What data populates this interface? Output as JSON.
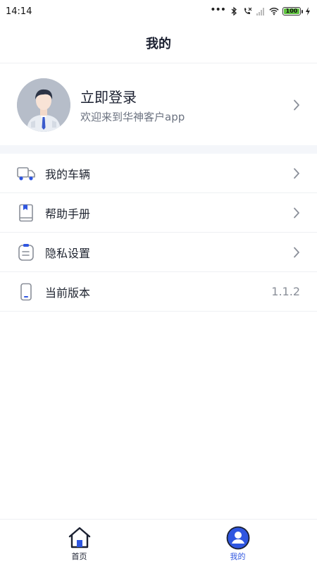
{
  "status_bar": {
    "time": "14:14",
    "dots": "•••",
    "battery": "100",
    "icons": [
      "bluetooth-icon",
      "no-call-icon",
      "no-signal-icon",
      "wifi-icon",
      "battery-icon",
      "charging-icon"
    ]
  },
  "header": {
    "title": "我的"
  },
  "profile": {
    "login_title": "立即登录",
    "welcome": "欢迎来到华神客户app"
  },
  "menu": {
    "items": [
      {
        "label": "我的车辆",
        "icon": "truck-icon"
      },
      {
        "label": "帮助手册",
        "icon": "book-icon"
      },
      {
        "label": "隐私设置",
        "icon": "clipboard-icon"
      },
      {
        "label": "当前版本",
        "icon": "phone-icon",
        "value": "1.1.2"
      }
    ]
  },
  "tabs": [
    {
      "label": "首页",
      "icon": "home-icon",
      "active": false
    },
    {
      "label": "我的",
      "icon": "user-icon",
      "active": true
    }
  ],
  "colors": {
    "accent": "#2f56e0",
    "text": "#1f2430",
    "muted": "#8a8f99",
    "divider": "#eef0f3",
    "section_bg": "#f4f6fa"
  }
}
